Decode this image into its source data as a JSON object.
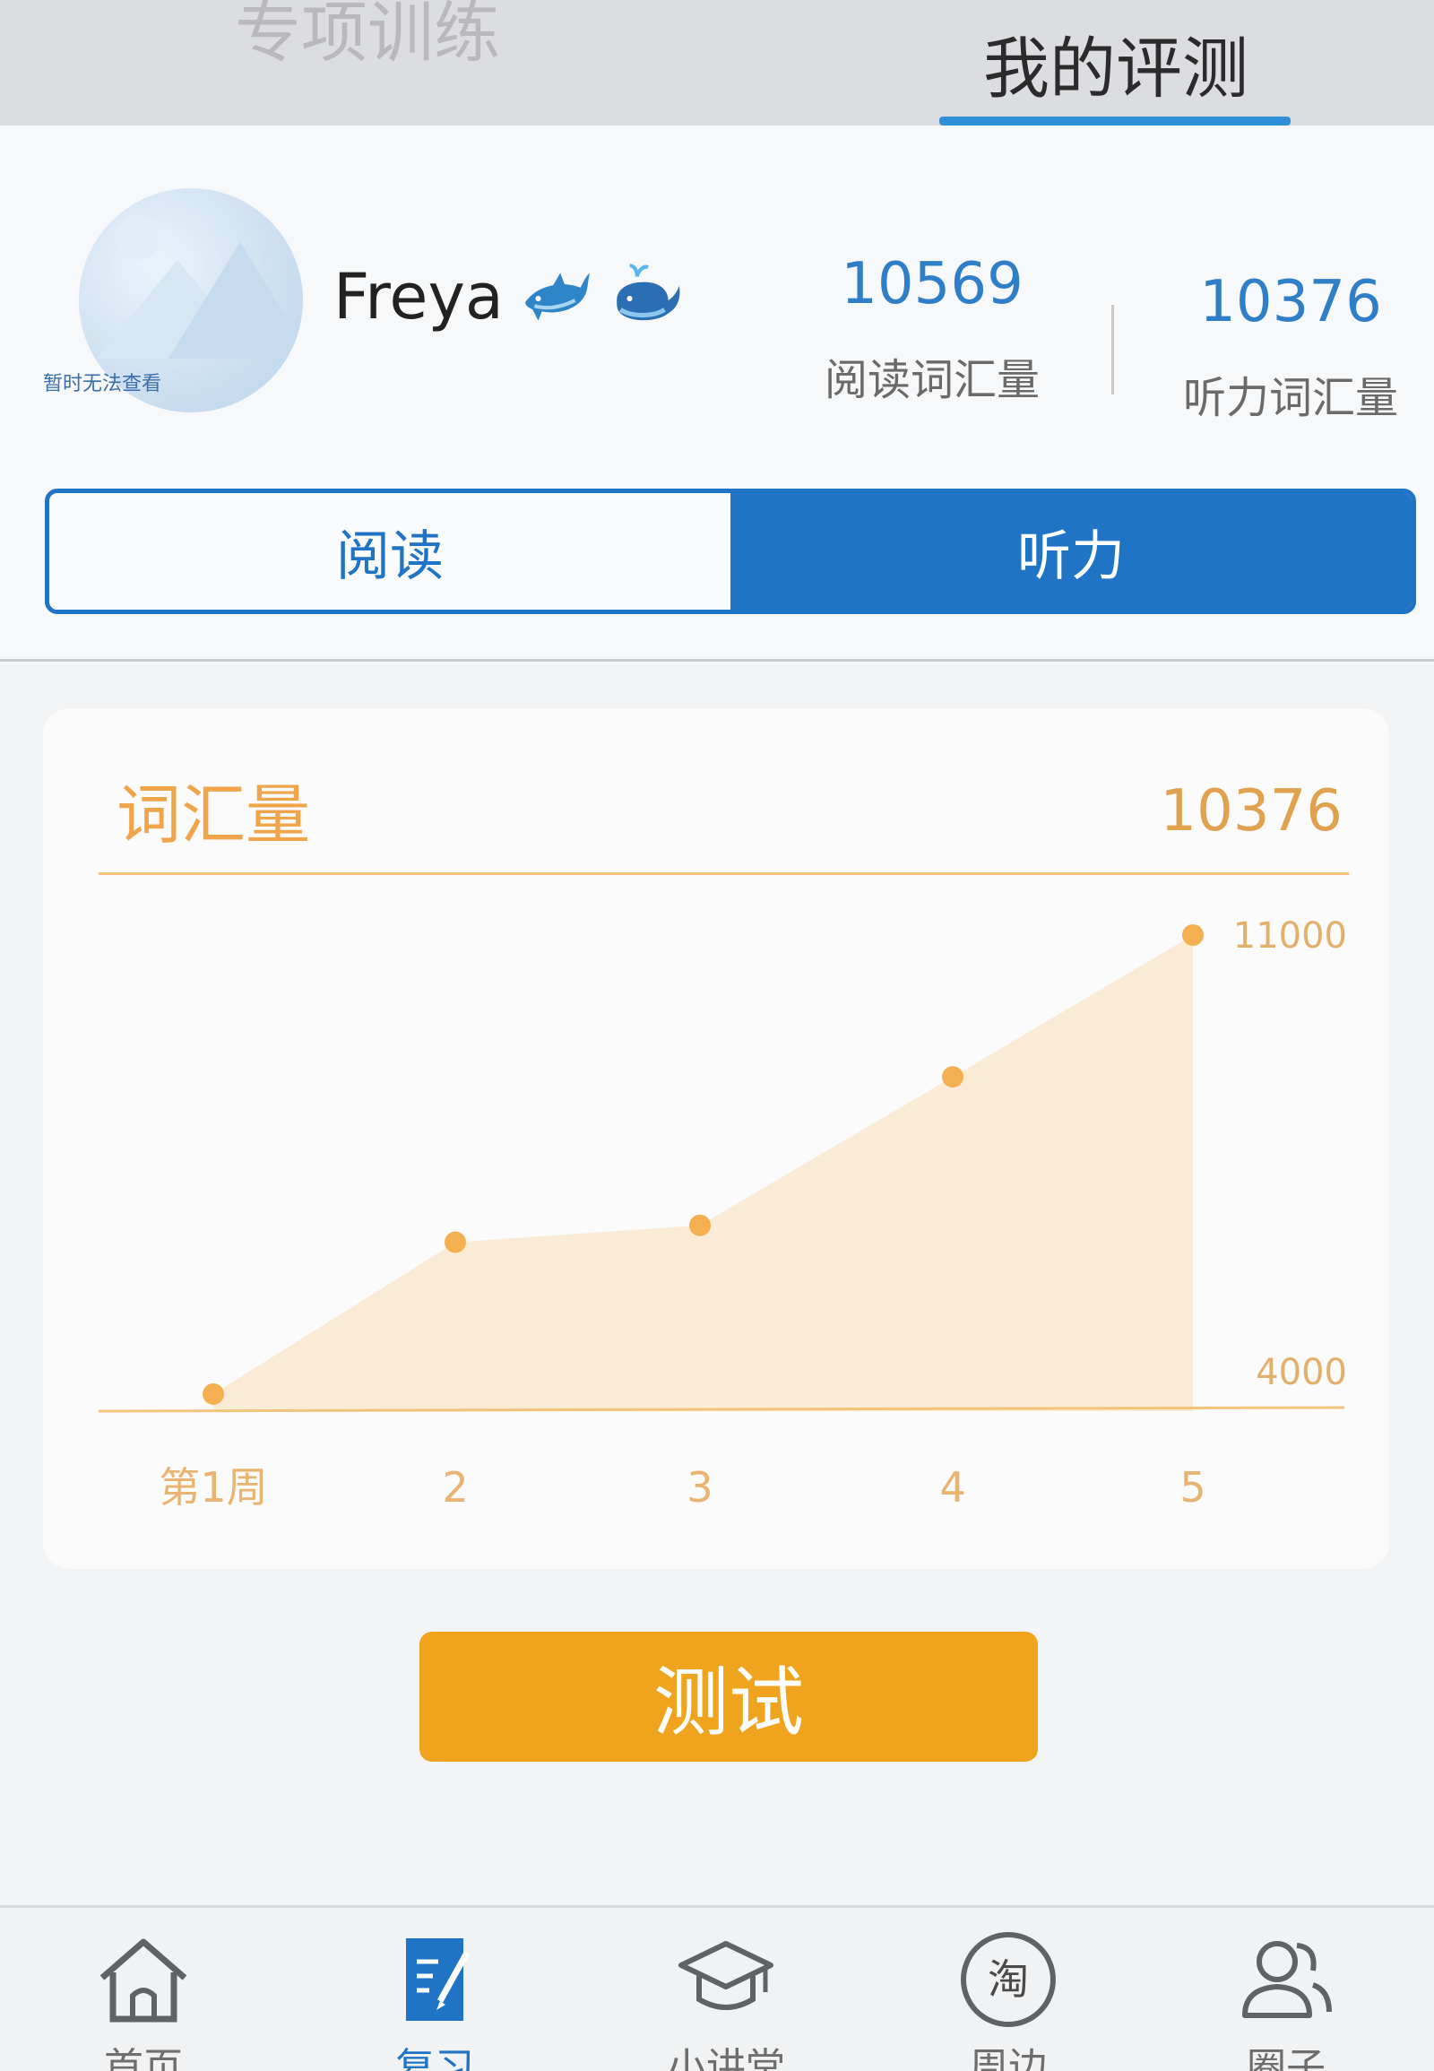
{
  "top_tabs": [
    {
      "label": "专项训练",
      "active": false
    },
    {
      "label": "我的评测",
      "active": true
    }
  ],
  "profile": {
    "avatar_caption": "暂时无法查看",
    "name": "Freya",
    "name_icons": [
      "dolphin-icon",
      "whale-icon"
    ],
    "stats": [
      {
        "value": "10569",
        "label": "阅读词汇量"
      },
      {
        "value": "10376",
        "label": "听力词汇量"
      }
    ]
  },
  "segment": {
    "options": [
      "阅读",
      "听力"
    ],
    "selected": "听力"
  },
  "chart_card": {
    "title": "词汇量",
    "current_value": "10376"
  },
  "chart_data": {
    "type": "area",
    "x": [
      "第1周",
      "2",
      "3",
      "4",
      "5"
    ],
    "y_ticks": [
      "11000",
      "4000"
    ],
    "ylim": [
      4000,
      11000
    ],
    "series": [
      {
        "values": [
          4200,
          6450,
          6700,
          8900,
          11000
        ]
      }
    ]
  },
  "test_button": {
    "label": "测试"
  },
  "bottom_nav": [
    {
      "label": "首页",
      "icon": "home-icon",
      "active": false
    },
    {
      "label": "复习",
      "icon": "review-icon",
      "active": true
    },
    {
      "label": "小讲堂",
      "icon": "graduation-cap-icon",
      "active": false
    },
    {
      "label": "周边",
      "icon": "tao-icon",
      "icon_text": "淘",
      "active": false
    },
    {
      "label": "圈子",
      "icon": "users-icon",
      "active": false
    }
  ],
  "colors": {
    "accent_blue": "#1f74c5",
    "accent_orange": "#f0a41d",
    "chart_orange": "#f0a54a"
  }
}
